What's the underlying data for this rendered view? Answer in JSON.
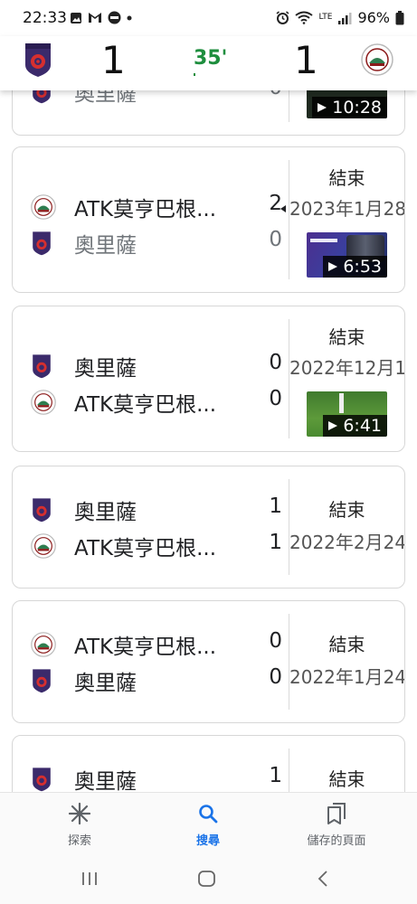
{
  "status_bar": {
    "time": "22:33",
    "battery": "96%",
    "network": "LTE"
  },
  "live_header": {
    "home_score": "1",
    "away_score": "1",
    "minute": "35'"
  },
  "matches": [
    {
      "team1": {
        "name": "奧里薩",
        "score": "0",
        "crest": "odisha-crest-icon",
        "winner": false
      },
      "team2": {
        "name": "",
        "score": "",
        "crest": "",
        "winner": false
      },
      "status": "",
      "date": "",
      "video_duration": "10:28"
    },
    {
      "team1": {
        "name": "ATK莫亨巴根...",
        "score": "2",
        "crest": "atk-mohun-bagan-crest-icon",
        "winner": true
      },
      "team2": {
        "name": "奧里薩",
        "score": "0",
        "crest": "odisha-crest-icon",
        "winner": false
      },
      "status": "結束",
      "date": "2023年1月28",
      "video_duration": "6:53"
    },
    {
      "team1": {
        "name": "奧里薩",
        "score": "0",
        "crest": "odisha-crest-icon",
        "winner": true
      },
      "team2": {
        "name": "ATK莫亨巴根...",
        "score": "0",
        "crest": "atk-mohun-bagan-crest-icon",
        "winner": true
      },
      "status": "結束",
      "date": "2022年12月1",
      "video_duration": "6:41"
    },
    {
      "team1": {
        "name": "奧里薩",
        "score": "1",
        "crest": "odisha-crest-icon",
        "winner": true
      },
      "team2": {
        "name": "ATK莫亨巴根...",
        "score": "1",
        "crest": "atk-mohun-bagan-crest-icon",
        "winner": true
      },
      "status": "結束",
      "date": "2022年2月24",
      "video_duration": ""
    },
    {
      "team1": {
        "name": "ATK莫亨巴根...",
        "score": "0",
        "crest": "atk-mohun-bagan-crest-icon",
        "winner": true
      },
      "team2": {
        "name": "奧里薩",
        "score": "0",
        "crest": "odisha-crest-icon",
        "winner": true
      },
      "status": "結束",
      "date": "2022年1月24",
      "video_duration": ""
    },
    {
      "team1": {
        "name": "奧里薩",
        "score": "1",
        "crest": "odisha-crest-icon",
        "winner": true
      },
      "team2": {
        "name": "",
        "score": "",
        "crest": "",
        "winner": false
      },
      "status": "結束",
      "date": "",
      "video_duration": ""
    }
  ],
  "bottom_nav": {
    "items": [
      {
        "label": "探索",
        "icon": "discover-asterisk-icon",
        "active": false
      },
      {
        "label": "搜尋",
        "icon": "search-icon",
        "active": true
      },
      {
        "label": "儲存的頁面",
        "icon": "saved-pages-icon",
        "active": false
      }
    ]
  },
  "colors": {
    "live_minute": "#1e8e3e",
    "active_nav": "#1a73e8",
    "odisha_purple": "#3b2a6b",
    "odisha_red": "#d62f2f",
    "atk_green": "#2e7d4f",
    "atk_maroon": "#8b1a1a"
  }
}
